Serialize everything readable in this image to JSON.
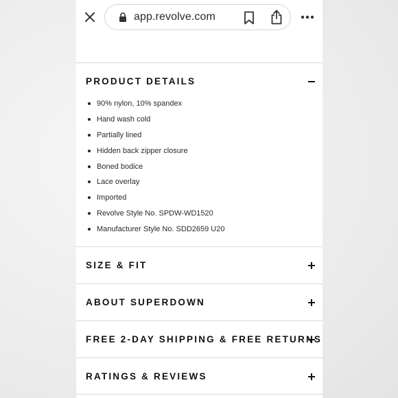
{
  "browser": {
    "url": "app.revolve.com",
    "close_icon": "close-icon",
    "lock_icon": "lock-icon",
    "bookmark_icon": "bookmark-icon",
    "share_icon": "share-icon",
    "more_icon": "more-horizontal-icon"
  },
  "sections": {
    "product_details": {
      "title": "PRODUCT DETAILS",
      "expanded": true,
      "items": [
        "90% nylon, 10% spandex",
        "Hand wash cold",
        "Partially lined",
        "Hidden back zipper closure",
        "Boned bodice",
        "Lace overlay",
        "Imported",
        "Revolve Style No. SPDW-WD1520",
        "Manufacturer Style No. SDD2659 U20"
      ]
    },
    "size_fit": {
      "title": "SIZE & FIT",
      "expanded": false
    },
    "about": {
      "title": "ABOUT SUPERDOWN",
      "expanded": false
    },
    "shipping": {
      "title": "FREE 2-DAY SHIPPING & FREE RETURNS",
      "expanded": false
    },
    "reviews": {
      "title": "RATINGS & REVIEWS",
      "expanded": false
    }
  },
  "colors": {
    "text": "#111111",
    "divider": "#d9d9d9",
    "background": "#ffffff"
  }
}
